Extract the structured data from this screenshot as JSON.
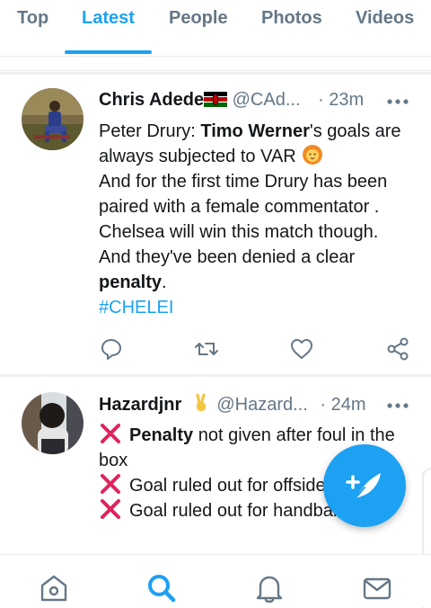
{
  "tabs": [
    {
      "label": "Top"
    },
    {
      "label": "Latest"
    },
    {
      "label": "People"
    },
    {
      "label": "Photos"
    },
    {
      "label": "Videos"
    }
  ],
  "active_tab": "Latest",
  "tweets": [
    {
      "name": "Chris Adede",
      "handle": "@CAd...",
      "time": "· 23m",
      "body": {
        "p1_pre": "Peter Drury: ",
        "p1_bold": "Timo Werner",
        "p1_post": "'s goals are always subjected to VAR",
        "p2": "And for the first time Drury has been paired with a female commentator .",
        "p3": "Chelsea will win this match though.",
        "p4_pre": "And they've been denied a clear ",
        "p4_bold": "penalty",
        "p4_post": ".",
        "hashtag": "#CHELEI"
      }
    },
    {
      "name": "Hazardjnr",
      "handle": "@Hazard...",
      "time": "· 24m",
      "body": {
        "l1_bold": "Penalty",
        "l1_post": " not given after foul in the box",
        "l2": "Goal ruled out for offside",
        "l3": "Goal ruled out for handball"
      }
    }
  ],
  "colors": {
    "accent": "#1da1f2",
    "text": "#14171a",
    "muted": "#657786",
    "cross": "#e0245e"
  },
  "icons": {
    "actions": [
      "reply-icon",
      "retweet-icon",
      "like-icon",
      "share-icon"
    ],
    "nav": [
      "home-icon",
      "search-icon",
      "notifications-icon",
      "messages-icon"
    ],
    "fab": "compose-tweet-icon"
  }
}
